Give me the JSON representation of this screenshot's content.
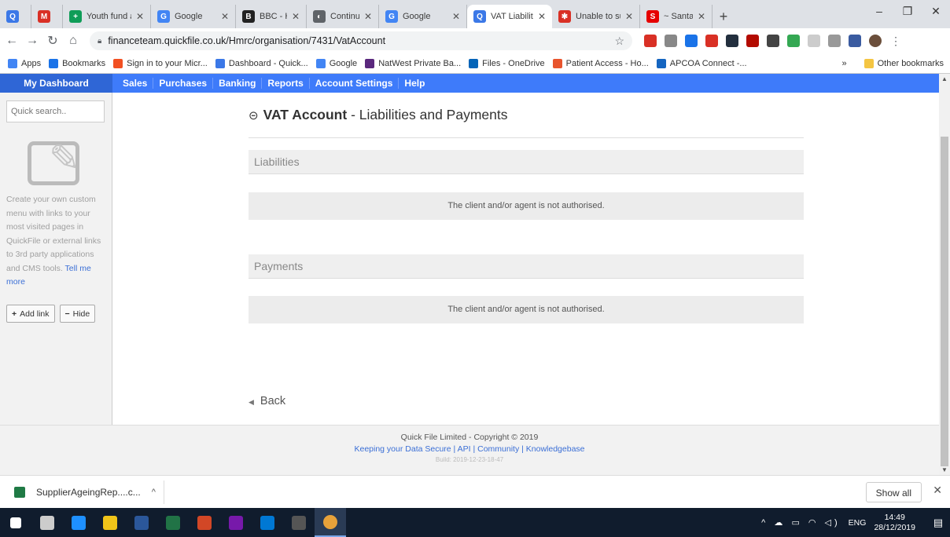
{
  "browser": {
    "tabs": [
      {
        "label": "",
        "color": "#3b78e7",
        "glyph": "Q"
      },
      {
        "label": "",
        "color": "#d93025",
        "glyph": "M"
      },
      {
        "label": "Youth fund a",
        "color": "#0f9d58",
        "glyph": "+"
      },
      {
        "label": "Google",
        "color": "#4285f4",
        "glyph": "G"
      },
      {
        "label": "BBC - Home",
        "color": "#222222",
        "glyph": "B"
      },
      {
        "label": "Continue",
        "color": "#5f6368",
        "glyph": "◐"
      },
      {
        "label": "Google",
        "color": "#4285f4",
        "glyph": "G"
      },
      {
        "label": "VAT Liabilitie",
        "color": "#3b78e7",
        "glyph": "Q",
        "active": true
      },
      {
        "label": "Unable to su",
        "color": "#d93025",
        "glyph": "✱"
      },
      {
        "label": "~ Santander",
        "color": "#e60000",
        "glyph": "S"
      }
    ],
    "new_tab": "+",
    "window_controls": [
      "–",
      "❐",
      "✕"
    ],
    "url": "financeteam.quickfile.co.uk/Hmrc/organisation/7431/VatAccount",
    "bookmarks": [
      {
        "label": "Apps",
        "color": "#4285f4"
      },
      {
        "label": "Bookmarks",
        "color": "#1a73e8"
      },
      {
        "label": "Sign in to your Micr...",
        "color": "#f25022"
      },
      {
        "label": "Dashboard - Quick...",
        "color": "#3b78e7"
      },
      {
        "label": "Google",
        "color": "#4285f4"
      },
      {
        "label": "NatWest Private Ba...",
        "color": "#5a287d"
      },
      {
        "label": "Files - OneDrive",
        "color": "#0364b8"
      },
      {
        "label": "Patient Access - Ho...",
        "color": "#e8542d"
      },
      {
        "label": "APCOA Connect -...",
        "color": "#1565c0"
      }
    ],
    "bookmarks_overflow": "»",
    "other_bookmarks": "Other bookmarks"
  },
  "app": {
    "nav": {
      "dashboard": "My Dashboard",
      "items": [
        "Sales",
        "Purchases",
        "Banking",
        "Reports",
        "Account Settings",
        "Help"
      ]
    },
    "sidebar": {
      "search_placeholder": "Quick search..",
      "description": "Create your own custom menu with links to your most visited pages in QuickFile or external links to 3rd party applications and CMS tools.",
      "tell_more": "Tell me more",
      "add_link": "Add link",
      "hide": "Hide"
    },
    "main": {
      "title_bold": "VAT Account",
      "title_rest": " - Liabilities and Payments",
      "liabilities_header": "Liabilities",
      "liabilities_message": "The client and/or agent is not authorised.",
      "payments_header": "Payments",
      "payments_message": "The client and/or agent is not authorised.",
      "back": "Back"
    },
    "footer": {
      "copyright": "Quick File Limited - Copyright © 2019",
      "links": "Keeping your Data Secure | API | Community | Knowledgebase",
      "build": "Build: 2019-12-23-18-47"
    }
  },
  "downloads": {
    "file": "SupplierAgeingRep....c...",
    "show_all": "Show all"
  },
  "taskbar": {
    "apps": [
      {
        "name": "windows-start-icon",
        "color": "#ffffff"
      },
      {
        "name": "task-view-icon",
        "color": "#cccccc"
      },
      {
        "name": "edge-icon",
        "color": "#1e90ff"
      },
      {
        "name": "file-explorer-icon",
        "color": "#f0c419"
      },
      {
        "name": "word-icon",
        "color": "#2b579a"
      },
      {
        "name": "excel-icon",
        "color": "#217346"
      },
      {
        "name": "powerpoint-icon",
        "color": "#d24726"
      },
      {
        "name": "onenote-icon",
        "color": "#7719aa"
      },
      {
        "name": "outlook-icon",
        "color": "#0078d4"
      },
      {
        "name": "calculator-icon",
        "color": "#555555"
      },
      {
        "name": "chrome-icon",
        "color": "#e8a23a"
      }
    ],
    "language": "ENG",
    "time": "14:49",
    "date": "28/12/2019"
  }
}
